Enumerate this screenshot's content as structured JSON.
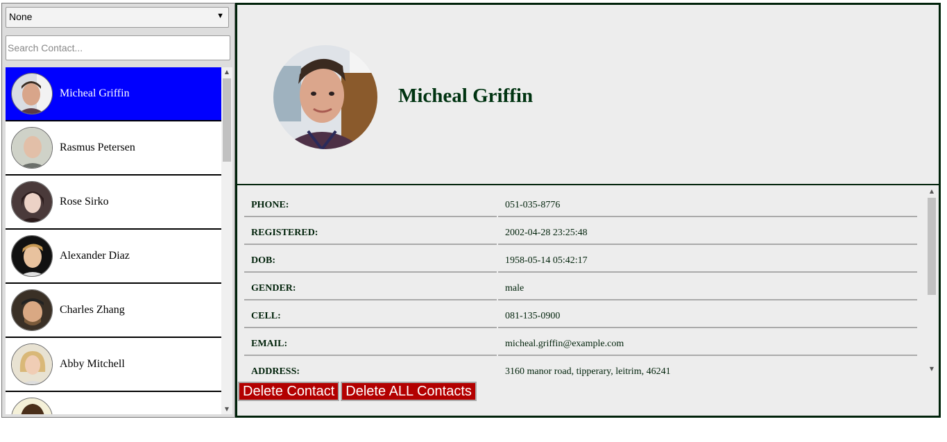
{
  "filter": {
    "selected": "None"
  },
  "search": {
    "placeholder": "Search Contact..."
  },
  "contacts": [
    {
      "name": "Micheal Griffin",
      "selected": true
    },
    {
      "name": "Rasmus Petersen"
    },
    {
      "name": "Rose Sirko"
    },
    {
      "name": "Alexander Diaz"
    },
    {
      "name": "Charles Zhang"
    },
    {
      "name": "Abby Mitchell"
    },
    {
      "name": ""
    }
  ],
  "profile": {
    "name": "Micheal Griffin",
    "details": [
      {
        "label": "PHONE:",
        "value": "051-035-8776"
      },
      {
        "label": "REGISTERED:",
        "value": "2002-04-28 23:25:48"
      },
      {
        "label": "DOB:",
        "value": "1958-05-14 05:42:17"
      },
      {
        "label": "GENDER:",
        "value": "male"
      },
      {
        "label": "CELL:",
        "value": "081-135-0900"
      },
      {
        "label": "EMAIL:",
        "value": "micheal.griffin@example.com"
      },
      {
        "label": "ADDRESS:",
        "value": "3160 manor road, tipperary, leitrim, 46241"
      }
    ]
  },
  "buttons": {
    "delete": "Delete Contact",
    "delete_all": "Delete ALL Contacts"
  },
  "colors": {
    "selected_bg": "#0000ff",
    "border_dark": "#00220a",
    "danger": "#b30000"
  }
}
